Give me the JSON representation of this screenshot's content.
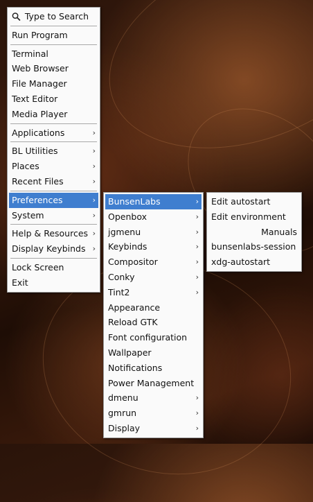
{
  "main_menu": {
    "search_label": "Type to Search",
    "items": [
      {
        "label": "Run Program"
      },
      {
        "label": "Terminal"
      },
      {
        "label": "Web Browser"
      },
      {
        "label": "File Manager"
      },
      {
        "label": "Text Editor"
      },
      {
        "label": "Media Player"
      },
      {
        "label": "Applications",
        "submenu": true
      },
      {
        "label": "BL Utilities",
        "submenu": true
      },
      {
        "label": "Places",
        "submenu": true
      },
      {
        "label": "Recent Files",
        "submenu": true
      },
      {
        "label": "Preferences",
        "submenu": true,
        "active": true
      },
      {
        "label": "System",
        "submenu": true
      },
      {
        "label": "Help & Resources",
        "submenu": true
      },
      {
        "label": "Display Keybinds",
        "submenu": true
      },
      {
        "label": "Lock Screen"
      },
      {
        "label": "Exit"
      }
    ]
  },
  "preferences_menu": {
    "items": [
      {
        "label": "BunsenLabs",
        "submenu": true,
        "active": true
      },
      {
        "label": "Openbox",
        "submenu": true
      },
      {
        "label": "jgmenu",
        "submenu": true
      },
      {
        "label": "Keybinds",
        "submenu": true
      },
      {
        "label": "Compositor",
        "submenu": true
      },
      {
        "label": "Conky",
        "submenu": true
      },
      {
        "label": "Tint2",
        "submenu": true
      },
      {
        "label": "Appearance"
      },
      {
        "label": "Reload GTK"
      },
      {
        "label": "Font configuration"
      },
      {
        "label": "Wallpaper"
      },
      {
        "label": "Notifications"
      },
      {
        "label": "Power Management"
      },
      {
        "label": "dmenu",
        "submenu": true
      },
      {
        "label": "gmrun",
        "submenu": true
      },
      {
        "label": "Display",
        "submenu": true
      }
    ]
  },
  "bunsenlabs_menu": {
    "items": [
      {
        "label": "Edit autostart"
      },
      {
        "label": "Edit environment"
      },
      {
        "label": "Manuals"
      },
      {
        "label": "bunsenlabs-session"
      },
      {
        "label": "xdg-autostart"
      }
    ]
  },
  "arrow_glyph": "›",
  "highlight_color": "#3f7ecf"
}
